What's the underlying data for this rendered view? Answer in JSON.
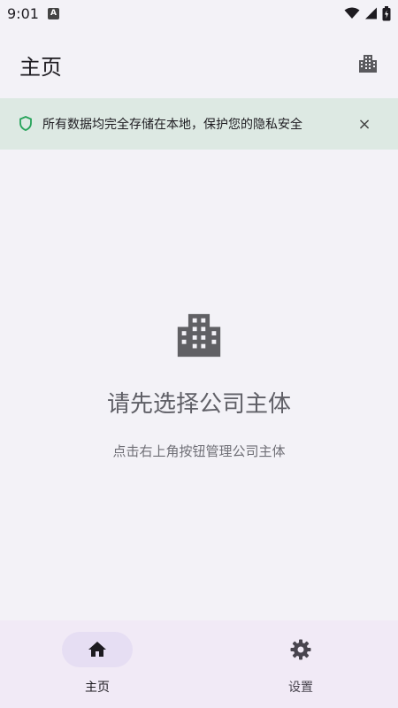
{
  "status_bar": {
    "time": "9:01"
  },
  "top_bar": {
    "title": "主页"
  },
  "banner": {
    "message": "所有数据均完全存储在本地，保护您的隐私安全",
    "close_symbol": "×"
  },
  "empty_state": {
    "title": "请先选择公司主体",
    "subtitle": "点击右上角按钮管理公司主体"
  },
  "bottom_nav": {
    "items": [
      {
        "label": "主页",
        "icon": "home-icon",
        "active": true
      },
      {
        "label": "设置",
        "icon": "gear-icon",
        "active": false
      }
    ]
  },
  "colors": {
    "background": "#f3f2f7",
    "banner_background": "#dde9e3",
    "shield": "#27a35a",
    "nav_background": "#f1eaf6",
    "nav_active_pill": "#e6def3"
  }
}
